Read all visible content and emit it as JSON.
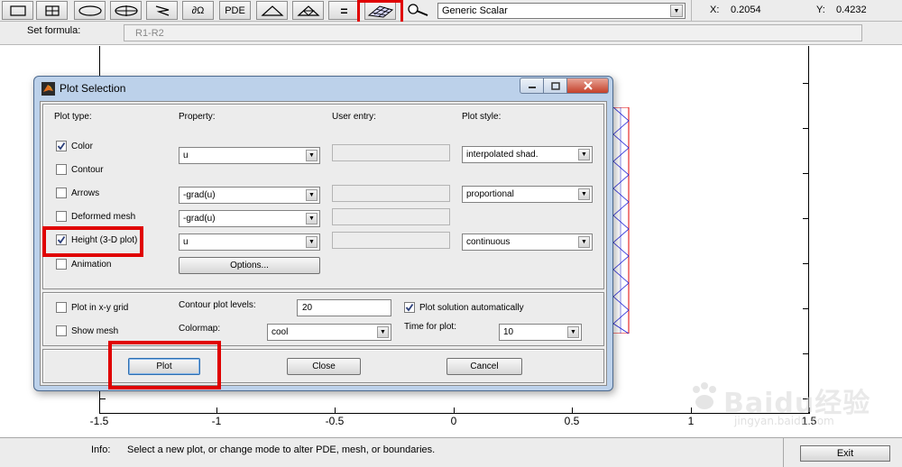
{
  "toolbar": {
    "tools": [
      {
        "name": "rectangle-tool",
        "icon": "rectangle-icon",
        "text": ""
      },
      {
        "name": "rectangle-centered-tool",
        "icon": "rectangle-centered-icon",
        "text": ""
      },
      {
        "name": "ellipse-tool",
        "icon": "ellipse-icon",
        "text": ""
      },
      {
        "name": "ellipse-centered-tool",
        "icon": "ellipse-centered-icon",
        "text": ""
      },
      {
        "name": "polygon-tool",
        "icon": "polygon-icon",
        "text": ""
      },
      {
        "name": "boundary-tool",
        "icon": "boundary-icon",
        "text": "∂Ω"
      },
      {
        "name": "pde-tool",
        "icon": "",
        "text": "PDE"
      },
      {
        "name": "init-mesh-tool",
        "icon": "triangle-icon",
        "text": ""
      },
      {
        "name": "refine-mesh-tool",
        "icon": "refined-triangle-icon",
        "text": ""
      },
      {
        "name": "solve-tool",
        "icon": "equals-icon",
        "text": "="
      },
      {
        "name": "plot-tool",
        "icon": "surface-plot-icon",
        "text": ""
      },
      {
        "name": "zoom-tool",
        "icon": "magnifier-icon",
        "text": ""
      }
    ],
    "app_mode": "Generic Scalar",
    "x_label": "X:",
    "x_value": "0.2054",
    "y_label": "Y:",
    "y_value": "0.4232"
  },
  "formula": {
    "label": "Set formula:",
    "value": "R1-R2"
  },
  "axes": {
    "x_ticks": [
      "-1.5",
      "-1",
      "-0.5",
      "0",
      "0.5",
      "1",
      "1.5"
    ]
  },
  "dialog": {
    "title": "Plot Selection",
    "headers": {
      "plot_type": "Plot type:",
      "property": "Property:",
      "user_entry": "User entry:",
      "plot_style": "Plot style:"
    },
    "rows": [
      {
        "key": "color",
        "label": "Color",
        "checked": true,
        "property": "u",
        "has_entry": true,
        "style": "interpolated shad."
      },
      {
        "key": "contour",
        "label": "Contour",
        "checked": false,
        "property": "",
        "has_entry": false,
        "style": ""
      },
      {
        "key": "arrows",
        "label": "Arrows",
        "checked": false,
        "property": "-grad(u)",
        "has_entry": true,
        "style": "proportional"
      },
      {
        "key": "deformed-mesh",
        "label": "Deformed mesh",
        "checked": false,
        "property": "-grad(u)",
        "has_entry": true,
        "style": ""
      },
      {
        "key": "height",
        "label": "Height (3-D plot)",
        "checked": true,
        "property": "u",
        "has_entry": true,
        "style": "continuous"
      },
      {
        "key": "animation",
        "label": "Animation",
        "checked": false,
        "property": "",
        "has_entry": false,
        "style": ""
      }
    ],
    "options_button": "Options...",
    "plot_in_grid": {
      "label": "Plot in x-y grid",
      "checked": false
    },
    "show_mesh": {
      "label": "Show mesh",
      "checked": false
    },
    "contour_levels_label": "Contour plot levels:",
    "contour_levels_value": "20",
    "colormap_label": "Colormap:",
    "colormap_value": "cool",
    "auto_plot": {
      "label": "Plot solution automatically",
      "checked": true
    },
    "time_label": "Time for plot:",
    "time_value": "10",
    "buttons": {
      "plot": "Plot",
      "close": "Close",
      "cancel": "Cancel"
    }
  },
  "info": {
    "label": "Info:",
    "text": "Select a new plot, or change mode to alter PDE, mesh, or boundaries.",
    "exit_label": "Exit"
  },
  "watermark": {
    "name": "Baidu经验",
    "domain": "jingyan.baidu.com"
  },
  "colors": {
    "annotation": "#e00000",
    "mesh_edge": "#1d1dd6",
    "mesh_boundary": "#e00000"
  }
}
